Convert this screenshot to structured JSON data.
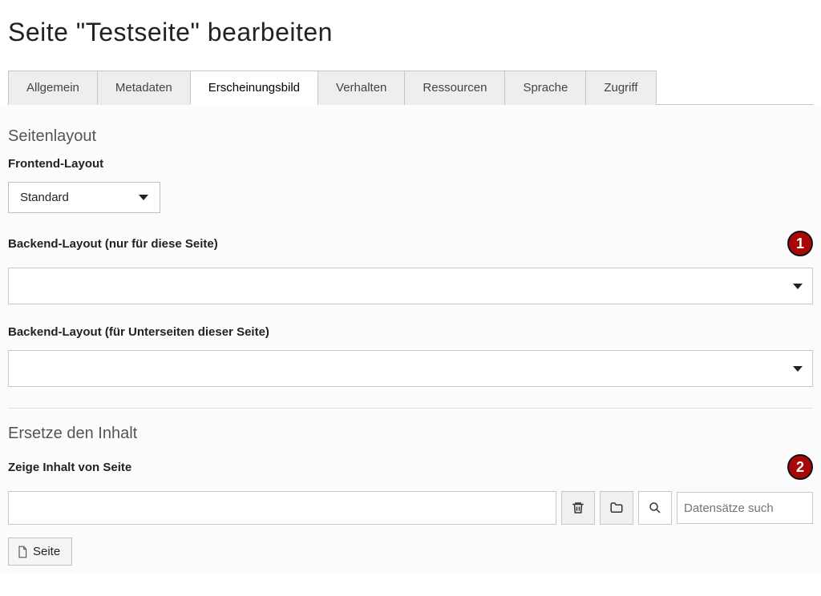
{
  "title": "Seite \"Testseite\" bearbeiten",
  "tabs": [
    "Allgemein",
    "Metadaten",
    "Erscheinungsbild",
    "Verhalten",
    "Ressourcen",
    "Sprache",
    "Zugriff"
  ],
  "active_tab_index": 2,
  "layout_section": {
    "heading": "Seitenlayout",
    "frontend_label": "Frontend-Layout",
    "frontend_value": "Standard",
    "backend_this_label": "Backend-Layout (nur für diese Seite)",
    "backend_sub_label": "Backend-Layout (für Unterseiten dieser Seite)",
    "badge1": "1"
  },
  "replace_section": {
    "heading": "Ersetze den Inhalt",
    "show_from_label": "Zeige Inhalt von Seite",
    "badge2": "2",
    "search_placeholder": "Datensätze such",
    "page_button": "Seite"
  }
}
